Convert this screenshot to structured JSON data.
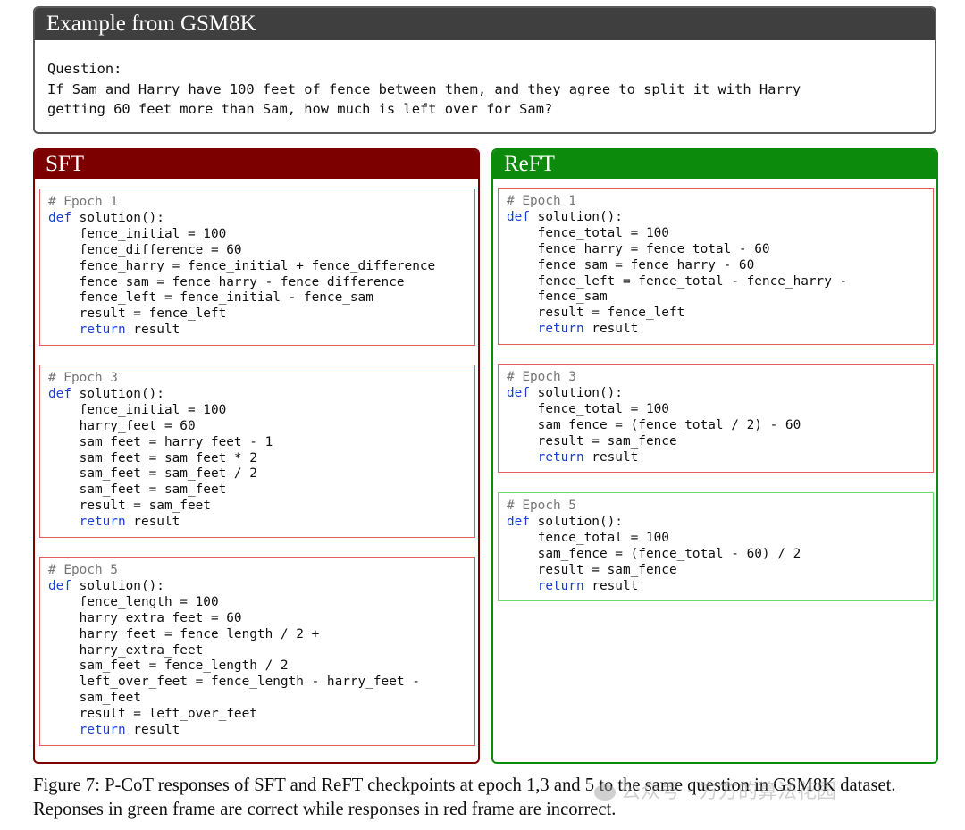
{
  "question_box": {
    "title": "Example from GSM8K",
    "label": "Question:",
    "text": "If Sam and Harry have 100 feet of fence between them, and they agree to split it with Harry\ngetting 60 feet more than Sam, how much is left over for Sam?"
  },
  "sft": {
    "title": "SFT",
    "boxes": [
      {
        "epoch_comment": "# Epoch 1",
        "def_kw": "def",
        "def_rest": " solution():",
        "body": "    fence_initial = 100\n    fence_difference = 60\n    fence_harry = fence_initial + fence_difference\n    fence_sam = fence_harry - fence_difference\n    fence_left = fence_initial - fence_sam\n    result = fence_left",
        "return_kw": "return",
        "return_rest": " result",
        "frame": "red"
      },
      {
        "epoch_comment": "# Epoch 3",
        "def_kw": "def",
        "def_rest": " solution():",
        "body": "    fence_initial = 100\n    harry_feet = 60\n    sam_feet = harry_feet - 1\n    sam_feet = sam_feet * 2\n    sam_feet = sam_feet / 2\n    sam_feet = sam_feet\n    result = sam_feet",
        "return_kw": "return",
        "return_rest": " result",
        "frame": "red"
      },
      {
        "epoch_comment": "# Epoch 5",
        "def_kw": "def",
        "def_rest": " solution():",
        "body": "    fence_length = 100\n    harry_extra_feet = 60\n    harry_feet = fence_length / 2 +\n    harry_extra_feet\n    sam_feet = fence_length / 2\n    left_over_feet = fence_length - harry_feet -\n    sam_feet\n    result = left_over_feet",
        "return_kw": "return",
        "return_rest": " result",
        "frame": "red"
      }
    ]
  },
  "reft": {
    "title": "ReFT",
    "boxes": [
      {
        "epoch_comment": "# Epoch 1",
        "def_kw": "def",
        "def_rest": " solution():",
        "body": "    fence_total = 100\n    fence_harry = fence_total - 60\n    fence_sam = fence_harry - 60\n    fence_left = fence_total - fence_harry -\n    fence_sam\n    result = fence_left",
        "return_kw": "return",
        "return_rest": " result",
        "frame": "red"
      },
      {
        "epoch_comment": "# Epoch 3",
        "def_kw": "def",
        "def_rest": " solution():",
        "body": "    fence_total = 100\n    sam_fence = (fence_total / 2) - 60\n    result = sam_fence",
        "return_kw": "return",
        "return_rest": " result",
        "frame": "red"
      },
      {
        "epoch_comment": "# Epoch 5",
        "def_kw": "def",
        "def_rest": " solution():",
        "body": "    fence_total = 100\n    sam_fence = (fence_total - 60) / 2\n    result = sam_fence",
        "return_kw": "return",
        "return_rest": " result",
        "frame": "green"
      }
    ]
  },
  "caption": "Figure 7: P-CoT responses of SFT and ReFT checkpoints at epoch 1,3 and 5 to the same question in GSM8K dataset. Reponses in green frame are correct while responses in red frame are incorrect.",
  "watermark": "公众号 · 方方的算法花园",
  "colors": {
    "sft": "#7d0000",
    "reft": "#0b8a0b",
    "incorrect_frame": "#e06060",
    "correct_frame": "#6bd96b",
    "keyword": "#1a3fd1",
    "comment": "#777777"
  }
}
